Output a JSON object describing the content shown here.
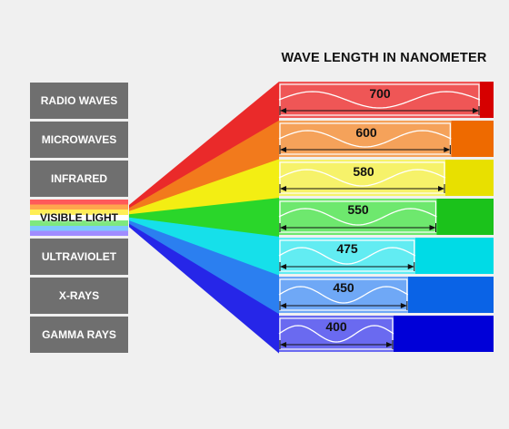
{
  "title": "WAVE LENGTH IN NANOMETER",
  "categories": [
    {
      "label": "RADIO WAVES"
    },
    {
      "label": "MICROWAVES"
    },
    {
      "label": "INFRARED"
    },
    {
      "label": "VISIBLE LIGHT"
    },
    {
      "label": "ULTRAVIOLET"
    },
    {
      "label": "X-RAYS"
    },
    {
      "label": "GAMMA RAYS"
    }
  ],
  "bands": [
    {
      "wavelength": "700",
      "value": 700,
      "color": "#ea2a2a",
      "light": "#ef5656",
      "strip": "#d60000"
    },
    {
      "wavelength": "600",
      "value": 600,
      "color": "#f27a1c",
      "light": "#f5a25a",
      "strip": "#ee6a00"
    },
    {
      "wavelength": "580",
      "value": 580,
      "color": "#f3ee13",
      "light": "#f6f26a",
      "strip": "#e8e000"
    },
    {
      "wavelength": "550",
      "value": 550,
      "color": "#2ad62a",
      "light": "#6ee86e",
      "strip": "#1bc21b"
    },
    {
      "wavelength": "475",
      "value": 475,
      "color": "#16e0ea",
      "light": "#62ecf2",
      "strip": "#00dbe6"
    },
    {
      "wavelength": "450",
      "value": 450,
      "color": "#2b7ff0",
      "light": "#6fa8f6",
      "strip": "#0a63e6"
    },
    {
      "wavelength": "400",
      "value": 400,
      "color": "#2626e8",
      "light": "#6a6af0",
      "strip": "#0000d8"
    }
  ]
}
